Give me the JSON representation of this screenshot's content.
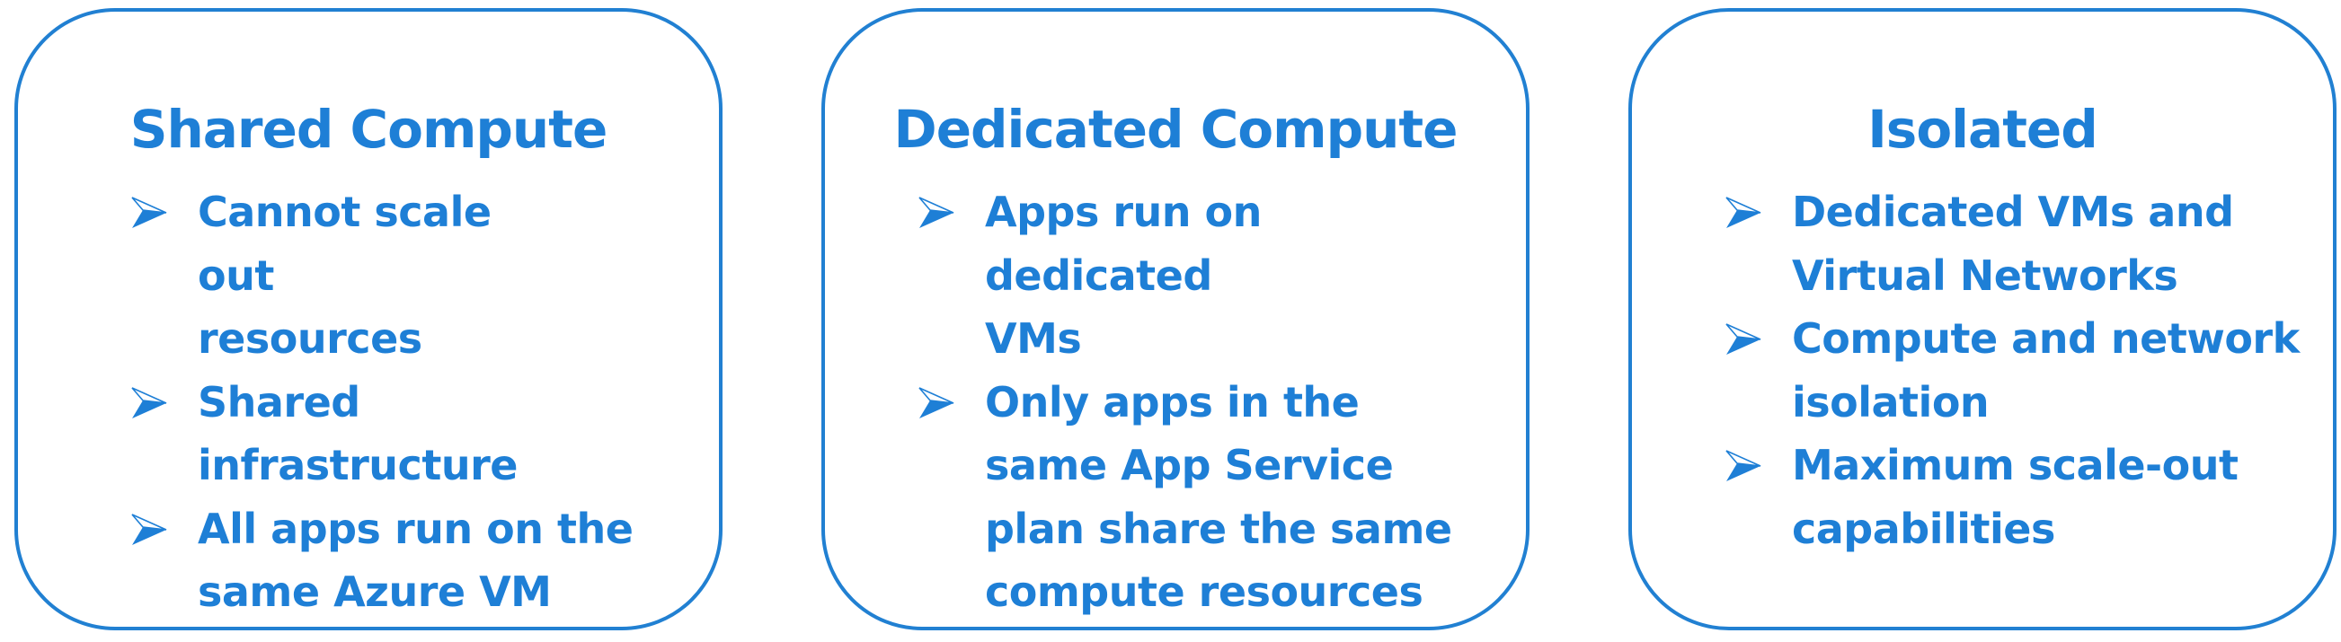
{
  "colors": {
    "accent": "#1E7FD6",
    "border": "#2180D2",
    "background": "#FFFFFF"
  },
  "bullet_icon": "arrowhead-bullet-icon",
  "cards": [
    {
      "title": "Shared Compute",
      "bullets": [
        "Cannot scale out resources",
        "Shared infrastructure",
        "All apps run on the same Azure VM"
      ]
    },
    {
      "title": "Dedicated Compute",
      "bullets": [
        "Apps run on dedicated VMs",
        "Only apps in the same App Service plan share the same compute resources"
      ]
    },
    {
      "title": "Isolated",
      "bullets": [
        "Dedicated VMs and Virtual Networks",
        "Compute and network isolation",
        "Maximum scale-out capabilities"
      ]
    }
  ]
}
